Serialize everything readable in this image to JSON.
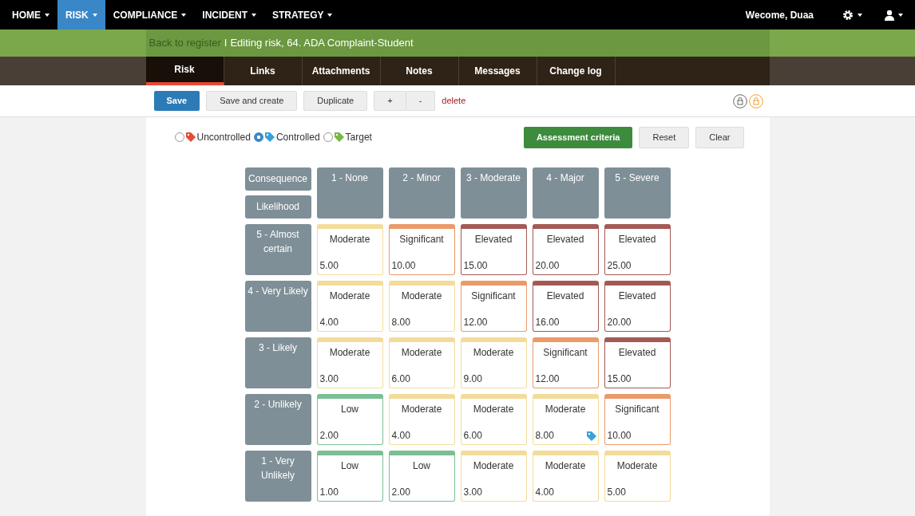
{
  "navbar": {
    "menus": [
      {
        "label": "HOME",
        "selected": false
      },
      {
        "label": "RISK",
        "selected": true
      },
      {
        "label": "COMPLIANCE",
        "selected": false
      },
      {
        "label": "INCIDENT",
        "selected": false
      },
      {
        "label": "STRATEGY",
        "selected": false
      }
    ],
    "welcome": "Wecome, Duaa"
  },
  "breadcrumb": {
    "back_link": "Back to register",
    "separator": "I",
    "title": "Editing risk, 64. ADA Complaint-Student"
  },
  "tabs": [
    {
      "label": "Risk",
      "selected": true
    },
    {
      "label": "Links",
      "selected": false
    },
    {
      "label": "Attachments",
      "selected": false
    },
    {
      "label": "Notes",
      "selected": false
    },
    {
      "label": "Messages",
      "selected": false
    },
    {
      "label": "Change log",
      "selected": false
    }
  ],
  "toolbar": {
    "save": "Save",
    "save_and_create": "Save and create",
    "duplicate": "Duplicate",
    "plus": "+",
    "minus": "-",
    "delete": "delete"
  },
  "assessment_types": [
    {
      "label": "Uncontrolled",
      "selected": false,
      "color": "#e8483a"
    },
    {
      "label": "Controlled",
      "selected": true,
      "color": "#3aa0d8"
    },
    {
      "label": "Target",
      "selected": false,
      "color": "#7ab648"
    }
  ],
  "actions": {
    "criteria": "Assessment criteria",
    "reset": "Reset",
    "clear": "Clear"
  },
  "matrix": {
    "consequence_label": "Consequence",
    "likelihood_label": "Likelihood",
    "columns": [
      "1 - None",
      "2 - Minor",
      "3 - Moderate",
      "4 - Major",
      "5 - Severe"
    ],
    "rows": [
      {
        "label": "5 - Almost certain",
        "cells": [
          {
            "rating": "Moderate",
            "score": "5.00",
            "color": "#f3dc9a",
            "tagged": false
          },
          {
            "rating": "Significant",
            "score": "10.00",
            "color": "#eb9a6a",
            "tagged": false
          },
          {
            "rating": "Elevated",
            "score": "15.00",
            "color": "#a35a55",
            "tagged": false
          },
          {
            "rating": "Elevated",
            "score": "20.00",
            "color": "#a35a55",
            "tagged": false
          },
          {
            "rating": "Elevated",
            "score": "25.00",
            "color": "#a35a55",
            "tagged": false
          }
        ]
      },
      {
        "label": "4 - Very Likely",
        "cells": [
          {
            "rating": "Moderate",
            "score": "4.00",
            "color": "#f3dc9a",
            "tagged": false
          },
          {
            "rating": "Moderate",
            "score": "8.00",
            "color": "#f3dc9a",
            "tagged": false
          },
          {
            "rating": "Significant",
            "score": "12.00",
            "color": "#eb9a6a",
            "tagged": false
          },
          {
            "rating": "Elevated",
            "score": "16.00",
            "color": "#a35a55",
            "tagged": false
          },
          {
            "rating": "Elevated",
            "score": "20.00",
            "color": "#a35a55",
            "tagged": false
          }
        ]
      },
      {
        "label": "3 - Likely",
        "cells": [
          {
            "rating": "Moderate",
            "score": "3.00",
            "color": "#f3dc9a",
            "tagged": false
          },
          {
            "rating": "Moderate",
            "score": "6.00",
            "color": "#f3dc9a",
            "tagged": false
          },
          {
            "rating": "Moderate",
            "score": "9.00",
            "color": "#f3dc9a",
            "tagged": false
          },
          {
            "rating": "Significant",
            "score": "12.00",
            "color": "#eb9a6a",
            "tagged": false
          },
          {
            "rating": "Elevated",
            "score": "15.00",
            "color": "#a35a55",
            "tagged": false
          }
        ]
      },
      {
        "label": "2 - Unlikely",
        "cells": [
          {
            "rating": "Low",
            "score": "2.00",
            "color": "#7bbf94",
            "tagged": false
          },
          {
            "rating": "Moderate",
            "score": "4.00",
            "color": "#f3dc9a",
            "tagged": false
          },
          {
            "rating": "Moderate",
            "score": "6.00",
            "color": "#f3dc9a",
            "tagged": false
          },
          {
            "rating": "Moderate",
            "score": "8.00",
            "color": "#f3dc9a",
            "tagged": true
          },
          {
            "rating": "Significant",
            "score": "10.00",
            "color": "#eb9a6a",
            "tagged": false
          }
        ]
      },
      {
        "label": "1 - Very Unlikely",
        "cells": [
          {
            "rating": "Low",
            "score": "1.00",
            "color": "#7bbf94",
            "tagged": false
          },
          {
            "rating": "Low",
            "score": "2.00",
            "color": "#7bbf94",
            "tagged": false
          },
          {
            "rating": "Moderate",
            "score": "3.00",
            "color": "#f3dc9a",
            "tagged": false
          },
          {
            "rating": "Moderate",
            "score": "4.00",
            "color": "#f3dc9a",
            "tagged": false
          },
          {
            "rating": "Moderate",
            "score": "5.00",
            "color": "#f3dc9a",
            "tagged": false
          }
        ]
      }
    ]
  }
}
